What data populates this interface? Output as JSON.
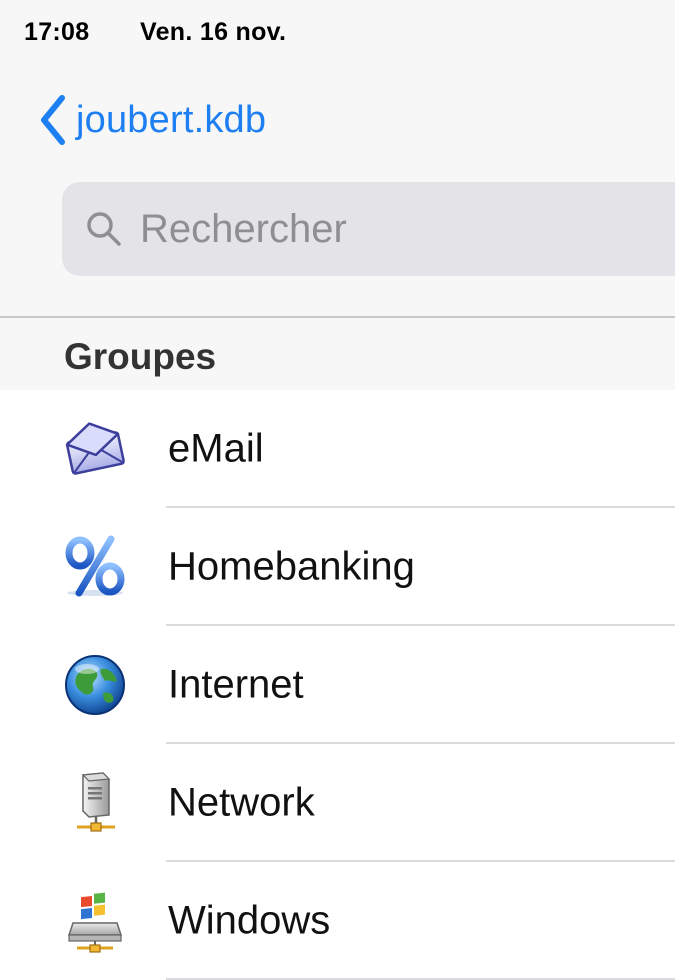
{
  "status_bar": {
    "time": "17:08",
    "date": "Ven. 16 nov."
  },
  "nav": {
    "back_label": "joubert.kdb",
    "accent_color": "#1d7ff2"
  },
  "search": {
    "placeholder": "Rechercher",
    "value": ""
  },
  "groups": {
    "header": "Groupes",
    "items": [
      {
        "label": "eMail",
        "icon": "envelope-icon"
      },
      {
        "label": "Homebanking",
        "icon": "percent-icon"
      },
      {
        "label": "Internet",
        "icon": "globe-icon"
      },
      {
        "label": "Network",
        "icon": "network-server-icon"
      },
      {
        "label": "Windows",
        "icon": "windows-drive-icon"
      }
    ]
  }
}
